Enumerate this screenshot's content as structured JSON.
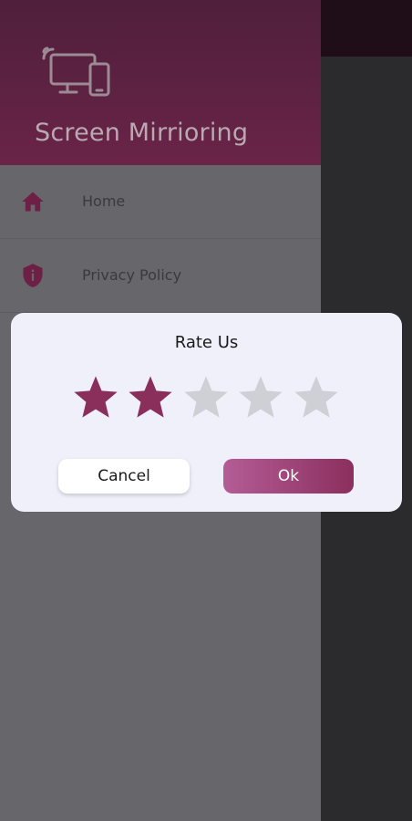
{
  "drawer": {
    "title": "Screen Mirrioring",
    "items": [
      {
        "label": "Home",
        "icon": "home-icon"
      },
      {
        "label": "Privacy Policy",
        "icon": "shield-info-icon"
      }
    ]
  },
  "dialog": {
    "title": "Rate Us",
    "rating": 2,
    "max_rating": 5,
    "cancel_label": "Cancel",
    "ok_label": "Ok"
  },
  "colors": {
    "header": "#5a2142",
    "drawer": "#67666b",
    "star_filled": "#8a2f5c",
    "star_empty": "#cfcfd6",
    "accent": "#a04478"
  }
}
